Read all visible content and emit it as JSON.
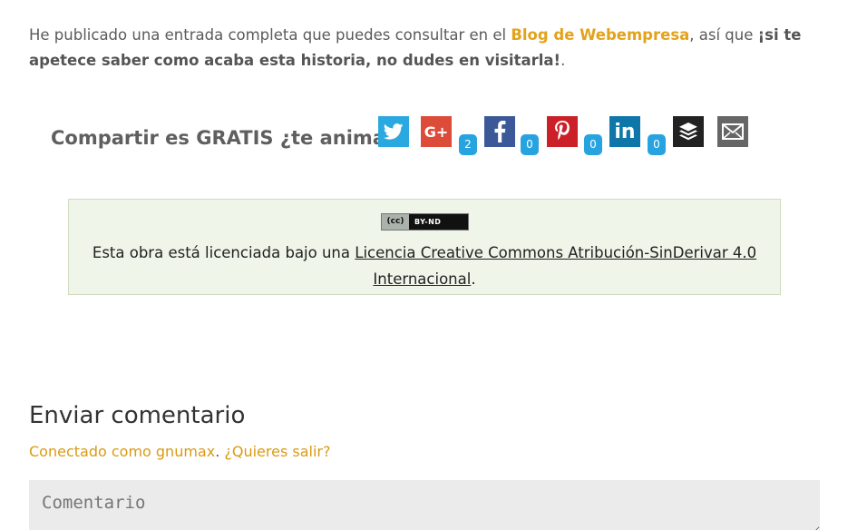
{
  "intro": {
    "prefix": "He publicado una entrada completa que puedes consultar en el ",
    "blog_link": "Blog de Webempresa",
    "middle": ", así que ",
    "bold_text": "¡si te apetece saber como acaba esta historia, no dudes en visitarla!",
    "suffix": "."
  },
  "share": {
    "title": "Compartir es GRATIS ¿te animas?",
    "buttons": [
      {
        "name": "twitter",
        "icon": "twitter-icon",
        "color": "#2aa9e0"
      },
      {
        "name": "google-plus",
        "icon": "google-plus-icon",
        "label": "G+",
        "count": "2",
        "color": "#dd4b39"
      },
      {
        "name": "facebook",
        "icon": "facebook-icon",
        "count": "0",
        "color": "#3b5998"
      },
      {
        "name": "pinterest",
        "icon": "pinterest-icon",
        "count": "0",
        "color": "#cb2027"
      },
      {
        "name": "linkedin",
        "icon": "linkedin-icon",
        "label": "in",
        "count": "0",
        "color": "#0e76a8"
      },
      {
        "name": "buffer",
        "icon": "buffer-icon",
        "color": "#222222"
      },
      {
        "name": "email",
        "icon": "envelope-icon",
        "color": "#666666"
      }
    ]
  },
  "license": {
    "badge_cc": "(cc)",
    "badge_text": "BY-ND",
    "text_prefix": "Esta obra está licenciada bajo una ",
    "link": "Licencia Creative Commons Atribución-SinDerivar 4.0 Internacional",
    "suffix": "."
  },
  "comments": {
    "title": "Enviar comentario",
    "logged_as": "Conectado como gnumax",
    "separator": ". ",
    "logout": "¿Quieres salir?",
    "placeholder": "Comentario"
  },
  "colors": {
    "accent": "#e3a21a",
    "license_bg": "#eff5e8",
    "count_badge": "#27a4e0"
  }
}
